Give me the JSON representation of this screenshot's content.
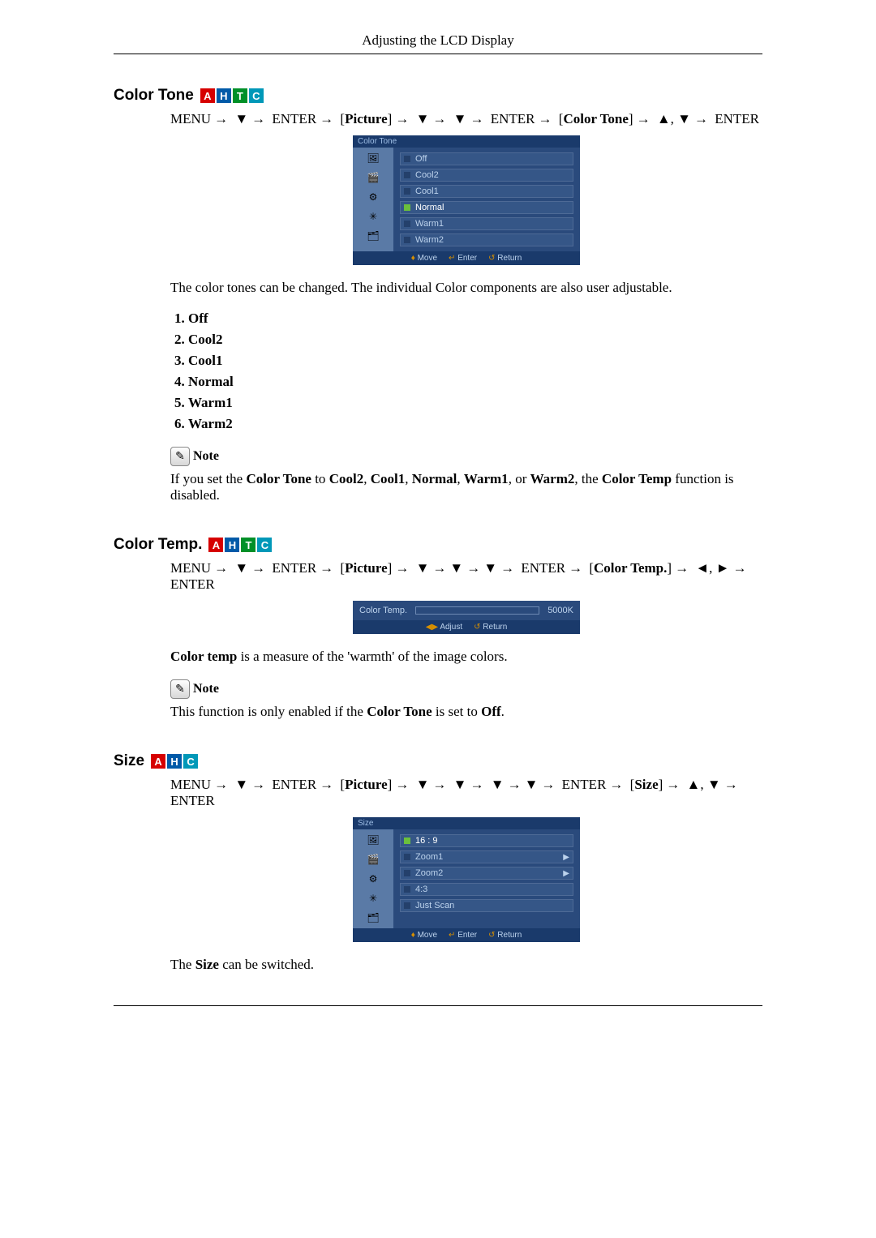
{
  "running_head": "Adjusting the LCD Display",
  "badges": {
    "a": "A",
    "h": "H",
    "t": "T",
    "c": "C"
  },
  "nav_tokens": {
    "menu": "MENU",
    "enter": "ENTER",
    "picture": "Picture",
    "color_tone": "Color Tone",
    "color_temp": "Color Temp.",
    "size": "Size"
  },
  "arrows": {
    "right": "→",
    "down": "▼",
    "up": "▲",
    "left": "◄",
    "rtri": "►",
    "comma": ", "
  },
  "note": {
    "label": "Note",
    "glyph": "✎"
  },
  "osd_footer": {
    "move": "Move",
    "enter": "Enter",
    "return": "Return",
    "adjust": "Adjust"
  },
  "osd_icons": {
    "pic": "🖼",
    "input": "🎬",
    "setup": "⚙",
    "option": "✳",
    "multi": "🗂"
  },
  "section_color_tone": {
    "title": "Color Tone",
    "osd_title": "Color Tone",
    "desc": "The color tones can be changed. The individual Color components are also user adjustable.",
    "items": {
      "1": "Off",
      "2": "Cool2",
      "3": "Cool1",
      "4": "Normal",
      "5": "Warm1",
      "6": "Warm2"
    },
    "note_prefix": "If you set the ",
    "note_t1": "Color Tone",
    "note_mid1": " to ",
    "note_t2": "Cool2",
    "note_c1": ", ",
    "note_t3": "Cool1",
    "note_c2": ", ",
    "note_t4": "Normal",
    "note_c3": ", ",
    "note_t5": "Warm1",
    "note_c4": ", or ",
    "note_t6": "Warm2",
    "note_mid2": ", the ",
    "note_t7": "Color Temp",
    "note_end": " function is disabled."
  },
  "section_color_temp": {
    "title": "Color Temp.",
    "osd_label": "Color Temp.",
    "osd_value": "5000K",
    "desc_b": "Color temp",
    "desc_rest": " is a measure of the 'warmth' of the image colors.",
    "note_prefix": "This function is only enabled if the ",
    "note_t1": "Color Tone",
    "note_mid": " is set to ",
    "note_t2": "Off",
    "note_end": "."
  },
  "section_size": {
    "title": "Size",
    "osd_title": "Size",
    "items": {
      "1": "16 : 9",
      "2": "Zoom1",
      "3": "Zoom2",
      "4": "4:3",
      "5": "Just Scan"
    },
    "desc_pre": "The ",
    "desc_b": "Size",
    "desc_post": " can be switched."
  }
}
